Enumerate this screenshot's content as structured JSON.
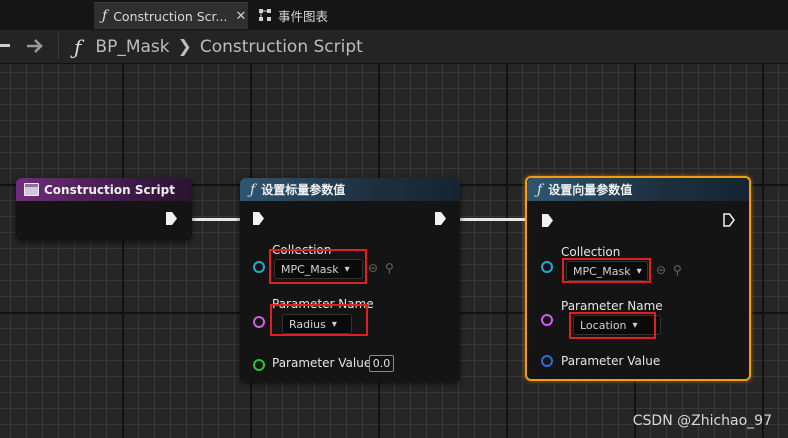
{
  "tabs": [
    {
      "label": "Construction Scr...",
      "close": "✕"
    },
    {
      "label": "事件图表"
    }
  ],
  "breadcrumb": {
    "asset": "BP_Mask",
    "separator": "❯",
    "graph": "Construction Script"
  },
  "nodes": {
    "construction": {
      "title": "Construction Script"
    },
    "scalar": {
      "title": "设置标量参数值",
      "collection_label": "Collection",
      "collection_value": "MPC_Mask",
      "param_name_label": "Parameter Name",
      "param_name_value": "Radius",
      "param_value_label": "Parameter Value",
      "param_value_value": "0.0"
    },
    "vector": {
      "title": "设置向量参数值",
      "collection_label": "Collection",
      "collection_value": "MPC_Mask",
      "param_name_label": "Parameter Name",
      "param_name_value": "Location",
      "param_value_label": "Parameter Value"
    }
  },
  "glyphs": {
    "function": "ƒ",
    "dropdown": "▾",
    "back": "⊖",
    "browse": "⚲"
  },
  "watermark": "CSDN @Zhichao_97",
  "colors": {
    "selection": "#f39c12",
    "highlight": "#e02020",
    "exec_wire": "#e8e8e8",
    "object_pin": "#1fa8d6",
    "name_pin": "#d35be8",
    "float_pin": "#27c23a",
    "vector_pin": "#2c6ed6"
  }
}
